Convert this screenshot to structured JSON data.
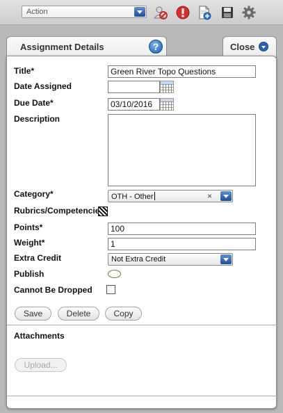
{
  "toolbar": {
    "action_select": "Action",
    "icons": [
      "remove-user-icon",
      "alert-icon",
      "new-document-icon",
      "save-disk-icon",
      "settings-gear-icon"
    ]
  },
  "tabs": {
    "details_label": "Assignment Details",
    "close_label": "Close"
  },
  "form": {
    "title_label": "Title*",
    "title_value": "Green River Topo Questions",
    "date_assigned_label": "Date Assigned",
    "date_assigned_value": "",
    "due_date_label": "Due Date*",
    "due_date_value": "03/10/2016",
    "description_label": "Description",
    "description_value": "",
    "category_label": "Category*",
    "category_value": "OTH - Other",
    "category_clear": "×",
    "rubrics_label": "Rubrics/Competencies",
    "points_label": "Points*",
    "points_value": "100",
    "weight_label": "Weight*",
    "weight_value": "1",
    "extra_credit_label": "Extra Credit",
    "extra_credit_value": "Not Extra Credit",
    "publish_label": "Publish",
    "publish_on": false,
    "cannot_drop_label": "Cannot Be Dropped",
    "cannot_drop_checked": false
  },
  "buttons": {
    "save": "Save",
    "delete": "Delete",
    "copy": "Copy"
  },
  "attachments": {
    "label": "Attachments",
    "upload": "Upload..."
  },
  "colors": {
    "accent_blue": "#2a63b1",
    "toolbar_bg": "#d6d6d6",
    "page_bg": "#b9b9b9"
  }
}
